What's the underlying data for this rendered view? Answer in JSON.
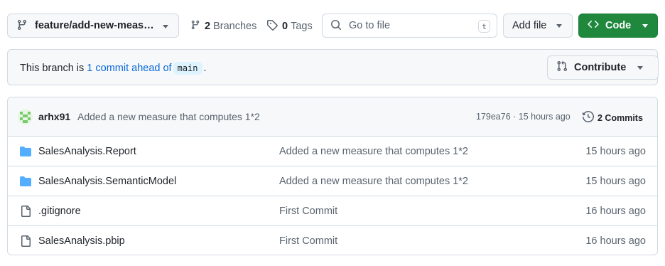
{
  "toolbar": {
    "branch_name": "feature/add-new-meas…",
    "branches_count": "2",
    "branches_label": "Branches",
    "tags_count": "0",
    "tags_label": "Tags",
    "goto_placeholder": "Go to file",
    "goto_shortcut": "t",
    "add_file_label": "Add file",
    "code_label": "Code"
  },
  "banner": {
    "prefix": "This branch is ",
    "link": "1 commit ahead of",
    "base_branch": "main",
    "suffix": ".",
    "contribute_label": "Contribute"
  },
  "latest_commit": {
    "author": "arhx91",
    "message": "Added a new measure that computes 1*2",
    "hash_time": "179ea76 · 15 hours ago",
    "commits_label": "2 Commits"
  },
  "files": [
    {
      "icon": "folder-icon",
      "name": "SalesAnalysis.Report",
      "message": "Added a new measure that computes 1*2",
      "time": "15 hours ago"
    },
    {
      "icon": "folder-icon",
      "name": "SalesAnalysis.SemanticModel",
      "message": "Added a new measure that computes 1*2",
      "time": "15 hours ago"
    },
    {
      "icon": "file-icon",
      "name": ".gitignore",
      "message": "First Commit",
      "time": "16 hours ago"
    },
    {
      "icon": "file-icon",
      "name": "SalesAnalysis.pbip",
      "message": "First Commit",
      "time": "16 hours ago"
    }
  ],
  "colors": {
    "primary_button": "#1f883d",
    "link": "#0969da",
    "folder": "#54aeff",
    "muted_text": "#59636e",
    "border": "#d1d9e0"
  }
}
